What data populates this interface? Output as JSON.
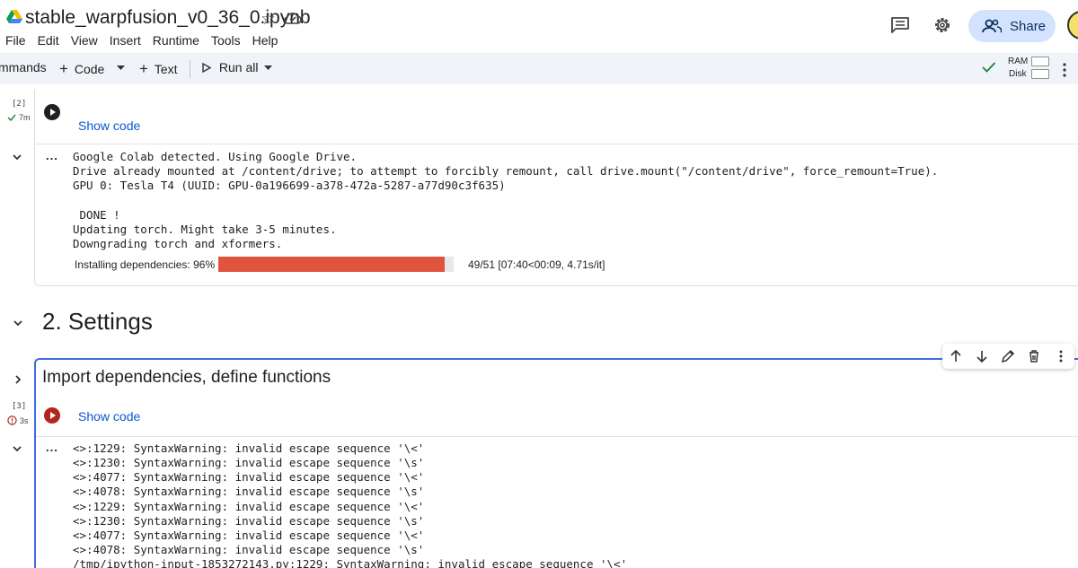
{
  "header": {
    "doc_title": "stable_warpfusion_v0_36_0.ipynb",
    "share_label": "Share",
    "icons": [
      "drive-logo",
      "star-icon",
      "cloud-icon",
      "comment-icon",
      "gear-icon",
      "share-icon",
      "avatar"
    ]
  },
  "menu": [
    "File",
    "Edit",
    "View",
    "Insert",
    "Runtime",
    "Tools",
    "Help"
  ],
  "toolbar": {
    "commands": "mmands",
    "code": "Code",
    "text": "Text",
    "run_all": "Run all",
    "ram_label": "RAM",
    "disk_label": "Disk"
  },
  "cell1": {
    "exec_count": "[2]",
    "exec_time": "7m",
    "show_code": "Show code",
    "output_dots": "...",
    "output_lines": [
      "Google Colab detected. Using Google Drive.",
      "Drive already mounted at /content/drive; to attempt to forcibly remount, call drive.mount(\"/content/drive\", force_remount=True).",
      "GPU 0: Tesla T4 (UUID: GPU-0a196699-a378-472a-5287-a77d90c3f635)",
      "",
      " DONE !",
      "Updating torch. Might take 3-5 minutes.",
      "Downgrading torch and xformers."
    ],
    "progress": {
      "label": "Installing dependencies:  96%",
      "fraction": 0.96,
      "stats": "49/51 [07:40<00:09,  4.71s/it]"
    }
  },
  "section": {
    "heading": "2. Settings"
  },
  "cell2": {
    "heading": "Import dependencies, define functions",
    "exec_count": "[3]",
    "exec_time": "3s",
    "show_code": "Show code",
    "output_dots": "...",
    "output_lines": [
      "<>:1229: SyntaxWarning: invalid escape sequence '\\<'",
      "<>:1230: SyntaxWarning: invalid escape sequence '\\s'",
      "<>:4077: SyntaxWarning: invalid escape sequence '\\<'",
      "<>:4078: SyntaxWarning: invalid escape sequence '\\s'",
      "<>:1229: SyntaxWarning: invalid escape sequence '\\<'",
      "<>:1230: SyntaxWarning: invalid escape sequence '\\s'",
      "<>:4077: SyntaxWarning: invalid escape sequence '\\<'",
      "<>:4078: SyntaxWarning: invalid escape sequence '\\s'",
      "/tmp/ipython-input-1853272143.py:1229: SyntaxWarning: invalid escape sequence '\\<'"
    ]
  },
  "colors": {
    "accent": "#0b57d0",
    "share_bg": "#d3e3fd",
    "progress": "#e0533f",
    "error": "#b3261e",
    "selected_cell_border": "#3d6ae0"
  }
}
